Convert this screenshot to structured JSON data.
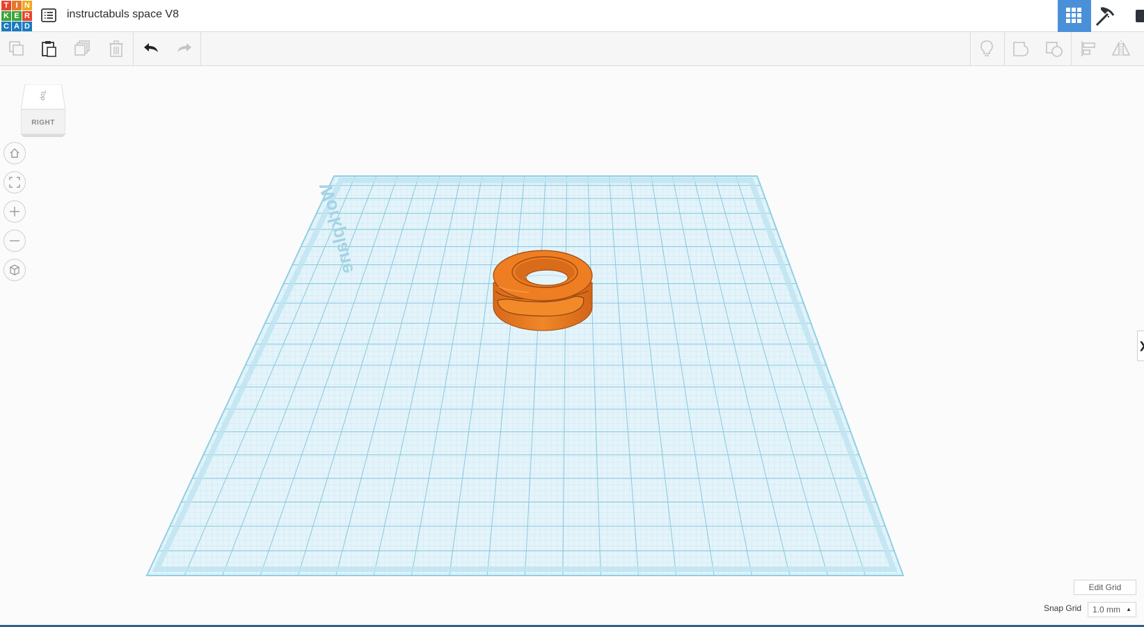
{
  "app": {
    "logo_letters": [
      "T",
      "I",
      "N",
      "K",
      "E",
      "R",
      "C",
      "A",
      "D"
    ],
    "logo_colors": [
      "#e8442c",
      "#e8772c",
      "#f0a91c",
      "#3ea33a",
      "#3ea33a",
      "#e8442c",
      "#1b7bbf",
      "#1b7bbf",
      "#1b7bbf"
    ],
    "document_title": "instructabuls space V8"
  },
  "toolbar": {
    "buttons": [
      "copy-icon",
      "paste-icon",
      "duplicate-icon",
      "delete-icon",
      "undo-icon",
      "redo-icon",
      "note-icon",
      "group-icon",
      "ungroup-icon",
      "align-icon",
      "mirror-icon"
    ]
  },
  "view_cube": {
    "face_front": "RIGHT",
    "face_top": "Top"
  },
  "workplane": {
    "label": "Workplane",
    "grid_color": "#9fd3e6",
    "shape_color": "#ef7d22"
  },
  "footer": {
    "edit_grid_label": "Edit Grid",
    "snap_grid_label": "Snap Grid",
    "snap_grid_value": "1.0 mm"
  },
  "colors": {
    "accent": "#4a90d9",
    "toolbar_bg": "#f6f6f6"
  }
}
